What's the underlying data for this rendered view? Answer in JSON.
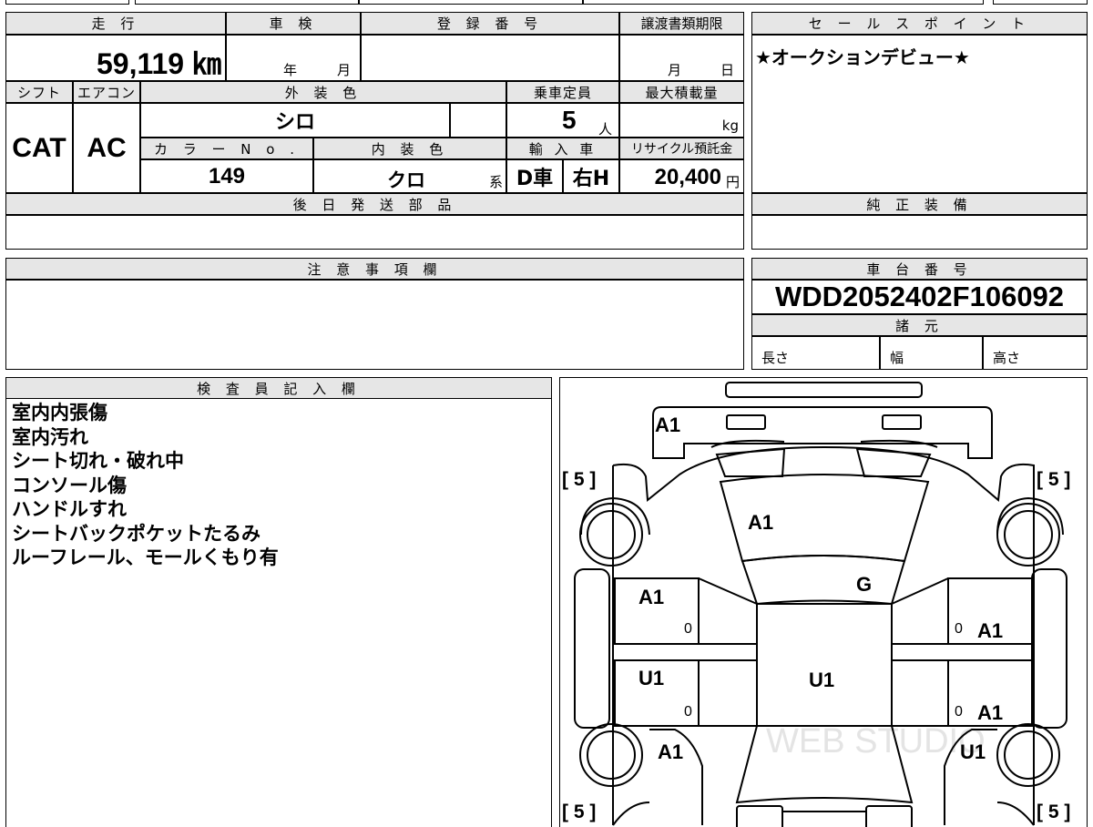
{
  "headers": {
    "mileage": "走 行",
    "inspection": "車 検",
    "registration_no": "登 録 番 号",
    "transfer_doc_deadline": "譲渡書類期限",
    "sales_point": "セ ー ル ス ポ イ ン ト",
    "shift": "シフト",
    "aircon": "エアコン",
    "exterior_color": "外 装 色",
    "capacity": "乗車定員",
    "max_load": "最大積載量",
    "color_no": "カ ラ ー N o .",
    "interior_color": "内 装 色",
    "import": "輸 入 車",
    "recycle_fee": "リサイクル預託金",
    "later_parts": "後 日 発 送 部 品",
    "genuine_equipment": "純 正 装 備",
    "notes": "注 意 事 項 欄",
    "chassis_no": "車 台 番 号",
    "specs": "諸 元",
    "inspector_notes": "検 査 員 記 入 欄"
  },
  "vehicle": {
    "mileage": "59,119 ㎞",
    "inspection_year_unit": "年",
    "inspection_month_unit": "月",
    "transfer_month_unit": "月",
    "transfer_day_unit": "日",
    "shift": "CAT",
    "aircon": "AC",
    "exterior_color": "シロ",
    "capacity": "5",
    "capacity_unit": "人",
    "max_load_unit": "kg",
    "color_no": "149",
    "interior_color": "クロ",
    "interior_suffix": "系",
    "import_type": "D車",
    "steering": "右H",
    "recycle_fee": "20,400",
    "recycle_unit": "円",
    "chassis_no": "WDD2052402F106092",
    "spec_length": "長さ",
    "spec_width": "幅",
    "spec_height": "高さ"
  },
  "sales_point_text": "★オークションデビュー★",
  "inspector_notes": [
    "室内内張傷",
    "室内汚れ",
    "シート切れ・破れ中",
    "コンソール傷",
    "ハンドルすれ",
    "シートバックポケットたるみ",
    "ルーフレール、モールくもり有"
  ],
  "diagram": {
    "labels": {
      "rear_bumper": "A1",
      "hood": "A1",
      "windshield": "G",
      "front_left_fender": "A1",
      "front_right_fender": "A1",
      "roof": "U1",
      "rear_left_door": "U1",
      "rear_right_door": "A1",
      "rear_left_quarter": "A1",
      "rear_right_quarter": "U1"
    },
    "tread": {
      "front_left": "[ 5 ]",
      "front_right": "[ 5 ]",
      "rear_left": "[ 5 ]",
      "rear_right": "[ 5 ]"
    },
    "zero_marks": [
      "0",
      "0",
      "0",
      "0"
    ],
    "watermark": "WEB STUDIO"
  }
}
